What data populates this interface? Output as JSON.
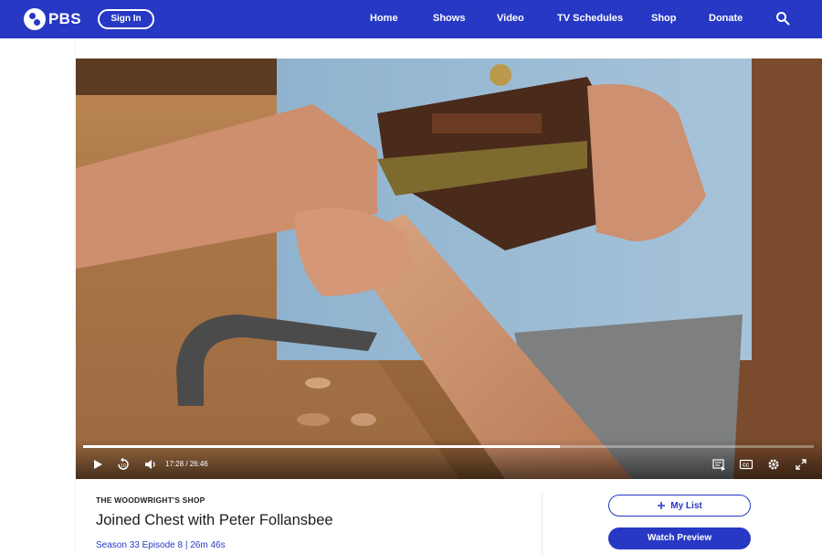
{
  "header": {
    "logo_text": "PBS",
    "signin_label": "Sign In",
    "nav": [
      "Home",
      "Shows",
      "Video",
      "TV Schedules",
      "Shop",
      "Donate"
    ],
    "search_icon": "search-icon"
  },
  "player": {
    "current_time": "17:28",
    "separator": "/",
    "duration": "26:46",
    "progress_fraction": 0.652,
    "controls": [
      "play-icon",
      "rewind-10-icon",
      "volume-icon",
      "chapters-icon",
      "closed-captions-icon",
      "settings-gear-icon",
      "fullscreen-icon"
    ],
    "rewind_label": "10",
    "cc_label": "CC"
  },
  "episode": {
    "show_name": "THE WOODWRIGHT'S SHOP",
    "title": "Joined Chest with Peter Follansbee",
    "season_episode": "Season 33 Episode 8",
    "meta_separator": "|",
    "runtime": "26m 46s"
  },
  "actions": {
    "my_list_label": "My List",
    "watch_preview_label": "Watch Preview"
  },
  "colors": {
    "brand_blue": "#2638c4",
    "text_dark": "#1d1d1d"
  }
}
